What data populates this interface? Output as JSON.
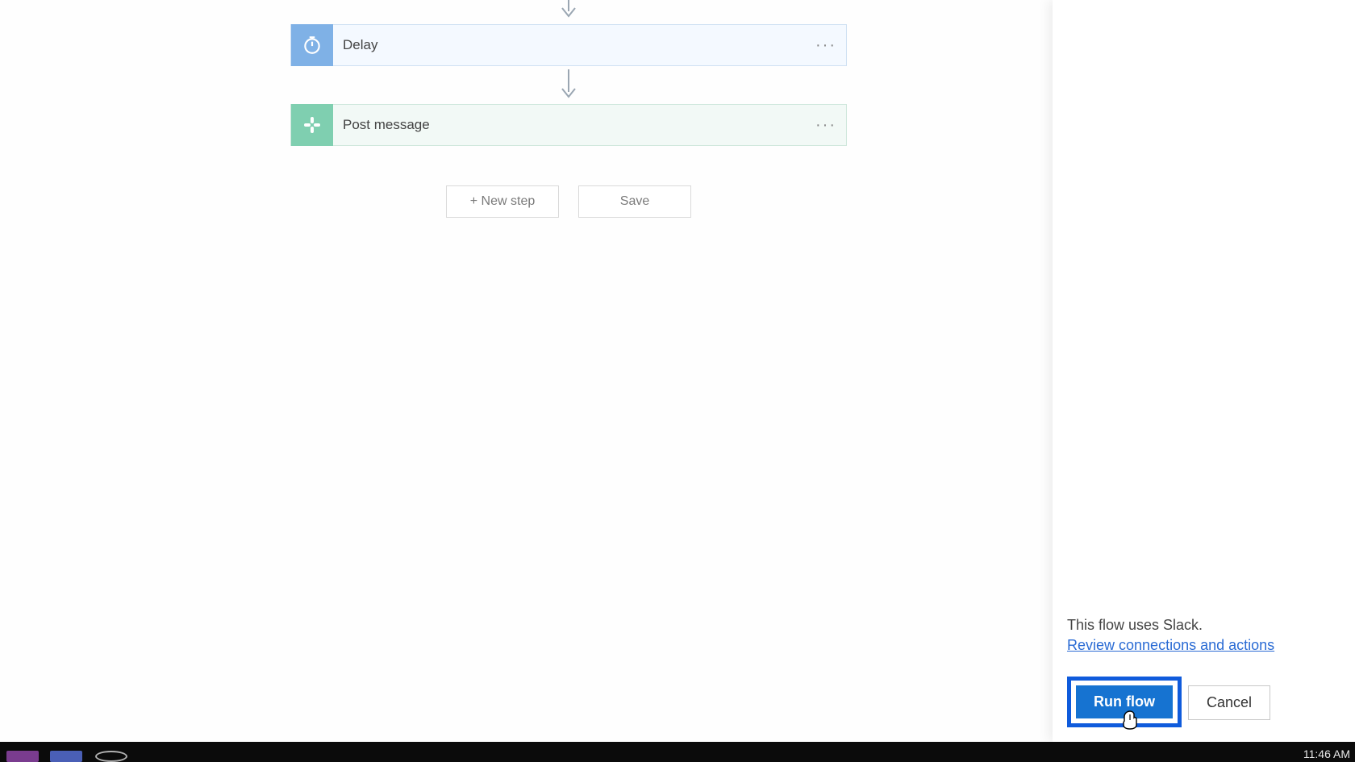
{
  "flow": {
    "cards": [
      {
        "title": "Delay",
        "icon": "timer-icon",
        "accent": "#7fb1e6",
        "bg": "#f4f9ff"
      },
      {
        "title": "Post message",
        "icon": "slack-icon",
        "accent": "#7fcfb0",
        "bg": "#f2f9f6"
      }
    ],
    "buttons": {
      "new_step": "+ New step",
      "save": "Save"
    }
  },
  "panel": {
    "info_text": "This flow uses Slack.",
    "review_link": "Review connections and actions",
    "run_label": "Run flow",
    "cancel_label": "Cancel"
  },
  "taskbar": {
    "clock": "11:46 AM"
  },
  "colors": {
    "primary_blue": "#1673d1",
    "focus_blue": "#0f5bdc",
    "link_blue": "#2a6bd4"
  }
}
